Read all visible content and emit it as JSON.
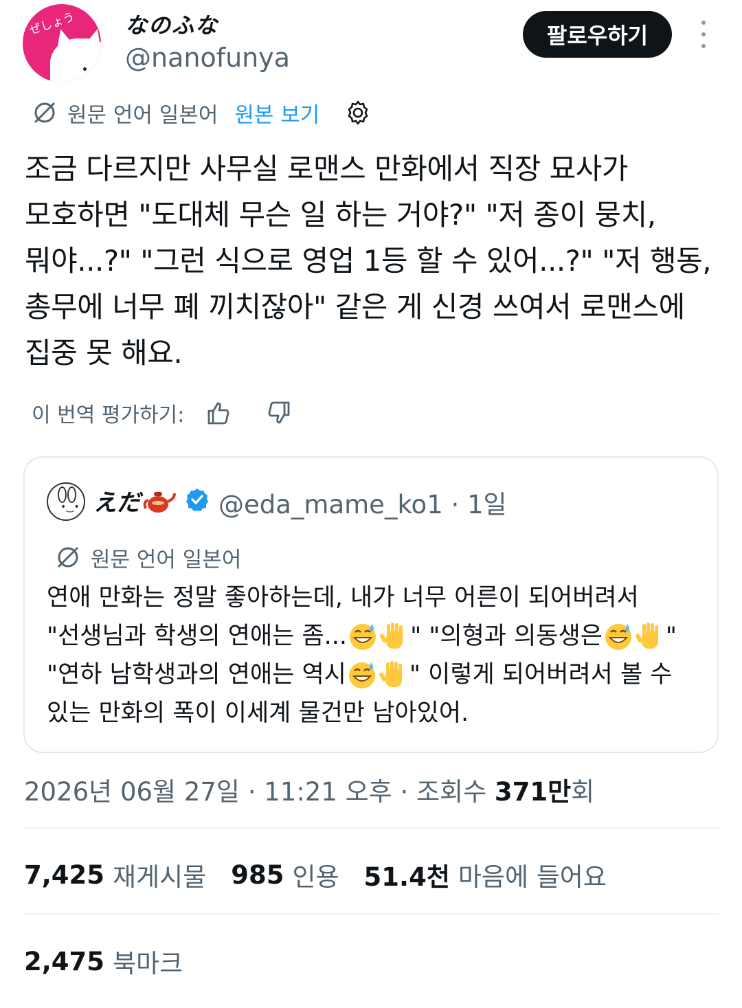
{
  "author": {
    "display_name": "なのふな",
    "handle": "@nanofunya",
    "avatar_text": "ぜしょう"
  },
  "follow_label": "팔로우하기",
  "translation": {
    "source_language": "원문 언어 일본어",
    "view_original": "원본 보기"
  },
  "tweet_lines": [
    "조금 다르지만 사무실 로맨스 만화에서 직장 묘사가",
    "모호하면 \"도대체 무슨 일 하는 거야?\" \"저 종이 뭉치,",
    "뭐야...?\" \"그런 식으로 영업 1등 할 수 있어...?\" \"저 행동,",
    "총무에 너무 폐 끼치잖아\" 같은 게 신경 쓰여서 로맨스에",
    "집중 못 해요."
  ],
  "rate_label": "이 번역 평가하기:",
  "quote": {
    "display_name": "えだ",
    "handle_time": "@eda_mame_ko1 · 1일",
    "source_language": "원문 언어 일본어",
    "line1": "연애 만화는 정말 좋아하는데, 내가 너무 어른이 되어버려서",
    "line2a": "\"선생님과 학생의 연애는 좀...",
    "line2b": "\" \"의형과 의동생은",
    "line2c": "\"",
    "line3a": "\"연하 남학생과의 연애는 역시",
    "line3b": "\" 이렇게 되어버려서 볼 수",
    "line4": "있는 만화의 폭이 이세계 물건만 남아있어."
  },
  "meta": {
    "datetime": "2026년 06월 27일 · 11:21 오후 · 조회수 ",
    "views": "371만",
    "views_suffix": "회"
  },
  "stats": {
    "reposts": "7,425",
    "reposts_label": "재게시물",
    "quotes": "985",
    "quotes_label": "인용",
    "likes": "51.4천",
    "likes_label": "마음에 들어요",
    "bookmarks": "2,475",
    "bookmarks_label": "북마크"
  },
  "colors": {
    "accent": "#1d9bf0",
    "avatar_bg": "#e8267a",
    "secondary_text": "#536471"
  }
}
